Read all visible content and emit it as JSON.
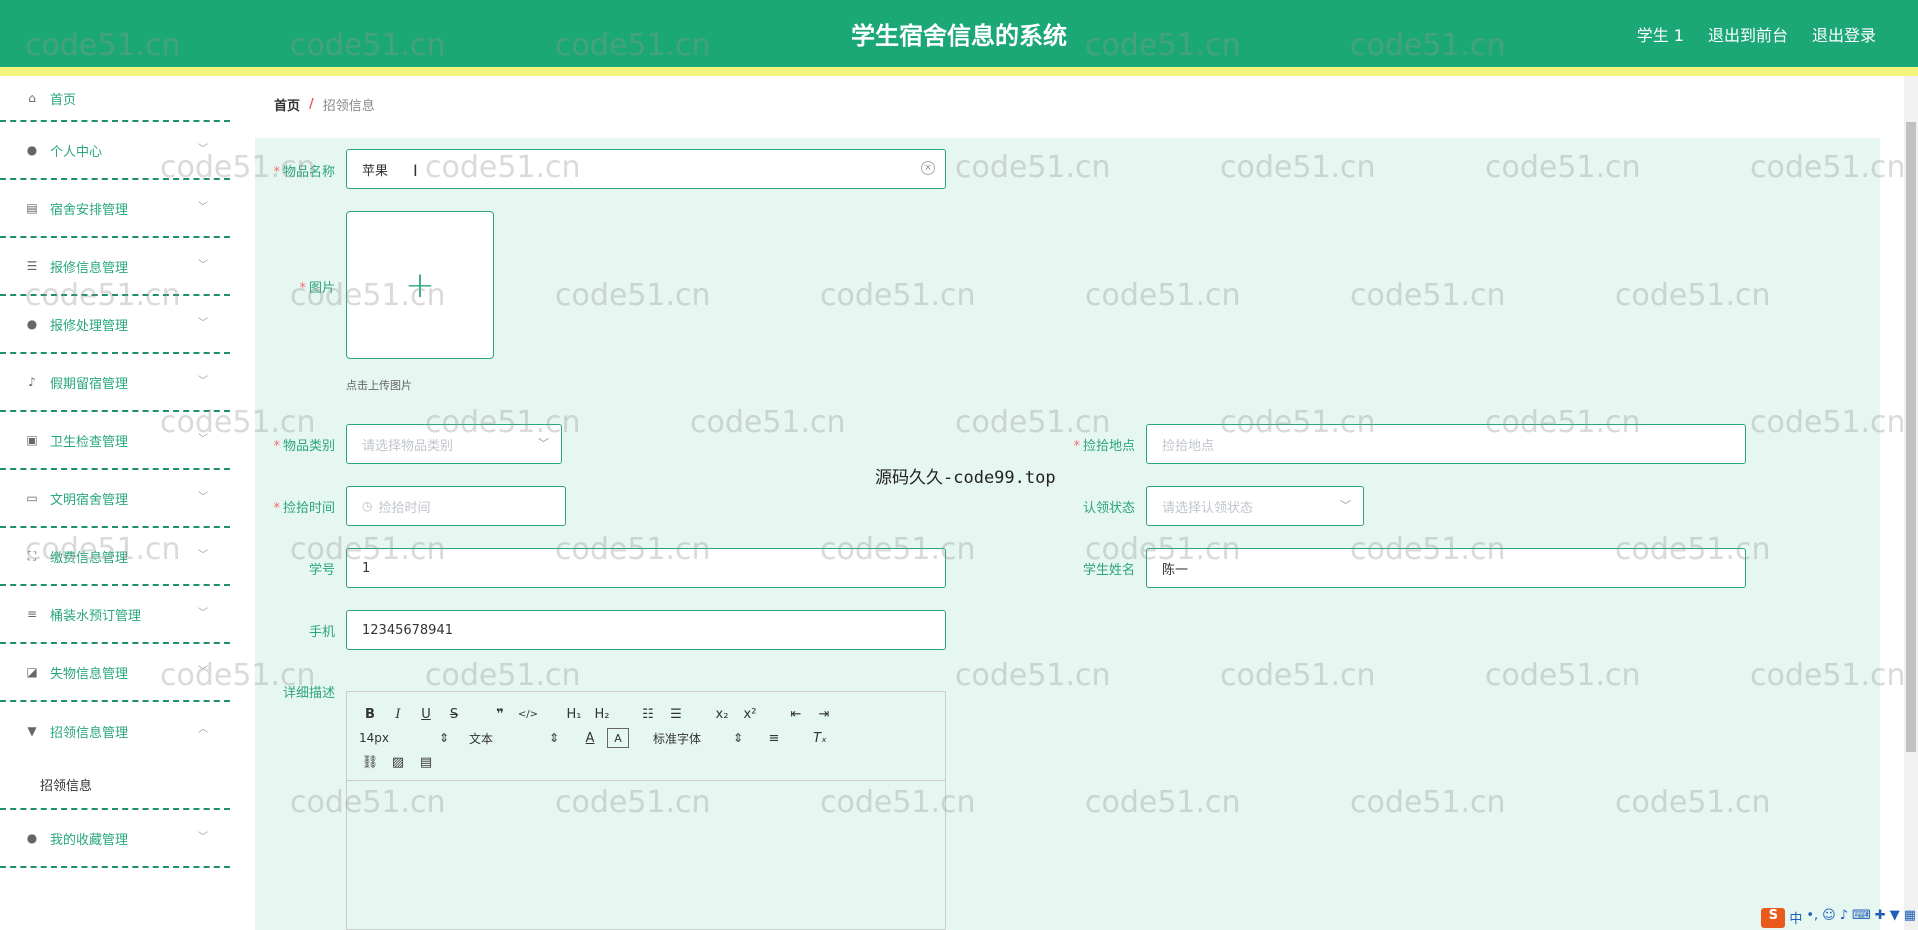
{
  "header": {
    "title": "学生宿舍信息的系统",
    "links": [
      "学生 1",
      "退出到前台",
      "退出登录"
    ]
  },
  "sidebar": {
    "items": [
      {
        "label": "首页",
        "icon": "home-icon"
      },
      {
        "label": "个人中心",
        "icon": "user-icon"
      },
      {
        "label": "宿舍安排管理",
        "icon": "clipboard-icon"
      },
      {
        "label": "报修信息管理",
        "icon": "sliders-icon"
      },
      {
        "label": "报修处理管理",
        "icon": "user-icon"
      },
      {
        "label": "假期留宿管理",
        "icon": "microphone-icon"
      },
      {
        "label": "卫生检查管理",
        "icon": "briefcase-icon"
      },
      {
        "label": "文明宿舍管理",
        "icon": "monitor-icon"
      },
      {
        "label": "缴费信息管理",
        "icon": "fullscreen-icon"
      },
      {
        "label": "桶装水预订管理",
        "icon": "menu-icon"
      },
      {
        "label": "失物信息管理",
        "icon": "chart-icon"
      },
      {
        "label": "招领信息管理",
        "icon": "brush-icon"
      },
      {
        "label": "我的收藏管理",
        "icon": "user-icon"
      }
    ],
    "sub_item": "招领信息"
  },
  "breadcrumb": {
    "home": "首页",
    "separator": "/",
    "current": "招领信息"
  },
  "form": {
    "item_name": {
      "label": "物品名称",
      "value": "苹果"
    },
    "image": {
      "label": "图片",
      "tip": "点击上传图片"
    },
    "category": {
      "label": "物品类别",
      "placeholder": "请选择物品类别"
    },
    "pickup_place": {
      "label": "捡拾地点",
      "placeholder": "捡拾地点"
    },
    "pickup_time": {
      "label": "捡拾时间",
      "placeholder": "捡拾时间"
    },
    "claim_status": {
      "label": "认领状态",
      "placeholder": "请选择认领状态"
    },
    "student_no": {
      "label": "学号",
      "value": "1"
    },
    "student_name": {
      "label": "学生姓名",
      "value": "陈一"
    },
    "phone": {
      "label": "手机",
      "value": "12345678941"
    },
    "description": {
      "label": "详细描述"
    }
  },
  "editor": {
    "font_size": "14px",
    "paragraph": "文本",
    "font_family": "标准字体"
  },
  "watermark": {
    "text": "code51.cn",
    "center_text": "源码久久-code99.top"
  },
  "ime": {
    "logo": "S",
    "lang": "中"
  },
  "colors": {
    "primary": "#1ca876",
    "accent_yellow": "#f5f37c",
    "panel_bg": "#e6f6f0",
    "required": "#f56c6c"
  }
}
